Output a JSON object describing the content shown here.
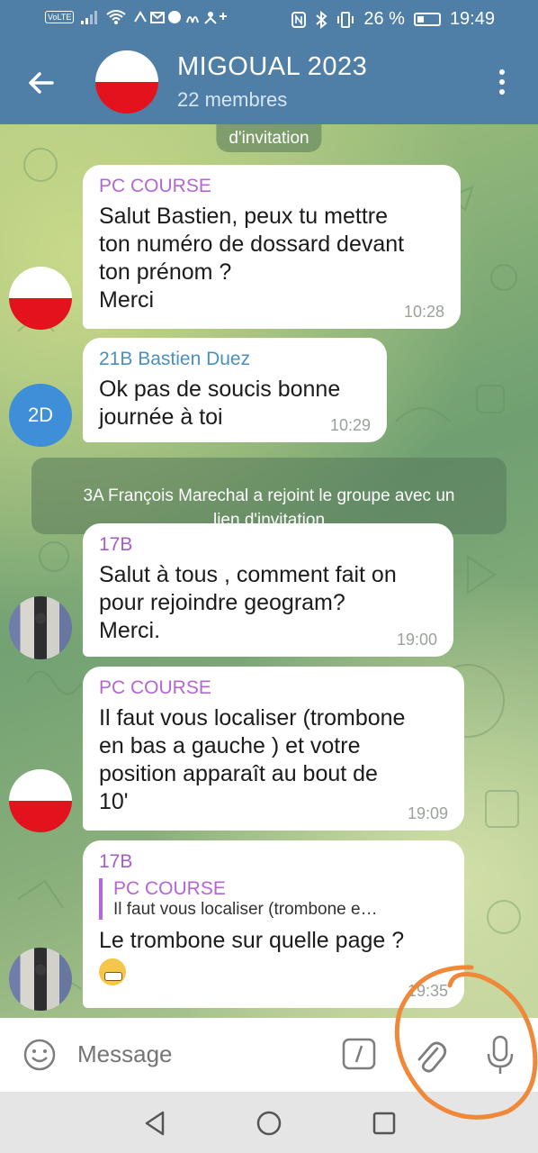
{
  "status_bar": {
    "volte": "VoLTE",
    "left_icons": [
      "signal-icon",
      "wifi-icon",
      "notification-icons"
    ],
    "battery_percent": "26 %",
    "time": "19:49"
  },
  "header": {
    "title": "MIGOUAL 2023",
    "subtitle": "22 membres"
  },
  "messages": {
    "service_top": "d'invitation",
    "m1": {
      "sender": "PC COURSE",
      "text": "Salut Bastien, peux tu mettre\nton numéro de dossard devant\nton prénom ?\nMerci",
      "time": "10:28"
    },
    "m2": {
      "sender": "21B Bastien Duez",
      "text": "Ok pas de soucis bonne\njournée à toi",
      "time": "10:29",
      "avatar_initials": "2D"
    },
    "service_join": "3A François Marechal a rejoint le groupe avec un\nlien d'invitation",
    "m3": {
      "sender": "17B",
      "text": "Salut à tous , comment fait on\npour rejoindre  geogram?\nMerci.",
      "time": "19:00"
    },
    "m4": {
      "sender": "PC COURSE",
      "text": "Il faut vous localiser (trombone\nen bas a gauche ) et votre\nposition apparaît au bout de\n10'",
      "time": "19:09"
    },
    "m5": {
      "sender": "17B",
      "reply_name": "PC COURSE",
      "reply_text": "Il faut vous localiser (trombone e…",
      "text": "Le trombone sur quelle page ?",
      "time": "19:35"
    }
  },
  "input": {
    "placeholder": "Message"
  },
  "colors": {
    "header": "#4f7fa7",
    "sender_pc": "#b466d4",
    "sender_21b": "#4b8fbf",
    "sender_17b": "#a35cc8",
    "annotation": "#f0883a"
  }
}
